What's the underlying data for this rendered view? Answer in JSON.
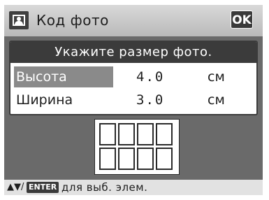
{
  "header": {
    "title": "Код фото",
    "ok_label": "OK"
  },
  "panel": {
    "prompt": "Укажите размер фото.",
    "rows": [
      {
        "label": "Высота",
        "value": "4.0",
        "unit": "см",
        "selected": true
      },
      {
        "label": "Ширина",
        "value": "3.0",
        "unit": "см",
        "selected": false
      }
    ]
  },
  "preview": {
    "columns": 4,
    "rows": 2
  },
  "footer": {
    "arrows": "▲▼/",
    "key_label": "ENTER",
    "hint": "для выб. элем."
  },
  "icons": {
    "title_icon": "photo-id-icon",
    "nav_icon": "up-down-arrows-icon"
  }
}
